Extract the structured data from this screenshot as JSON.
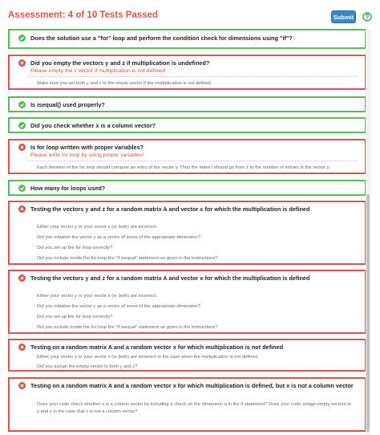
{
  "header": {
    "title": "Assessment: 4 of 10 Tests Passed",
    "submit_label": "Submit"
  },
  "colors": {
    "pass": "#5cb85c",
    "fail": "#d9534f",
    "submit": "#3a87c9",
    "help": "#3aa84a"
  },
  "tests": [
    {
      "status": "pass",
      "question": "Does the solution use a \"for\" loop and perform the condition check for dimensions using \"if\"?",
      "error": "",
      "hints": []
    },
    {
      "status": "fail",
      "question": "Did you empty the vectors y and z if multiplication is undefined?",
      "error": "Please empty the z vector if multiplication is not defined!",
      "hints": [
        "Make sure you set both y and z to the empty vector if the multiplication is not defined."
      ]
    },
    {
      "status": "pass",
      "question": "Is isequal() used properly?",
      "error": "",
      "hints": []
    },
    {
      "status": "pass",
      "question": "Did you check whether x is a column vector?",
      "error": "",
      "hints": []
    },
    {
      "status": "fail",
      "question": "Is for loop written with proper variables?",
      "error": "Please write for loop by using proper variables!",
      "hints": [
        "Each iteration of the for loop should compute an entry of the vector y. Thus the index  i  should go from 1 to the number of entries in the vector y."
      ]
    },
    {
      "status": "pass",
      "question": "How many for loops used?",
      "error": "",
      "hints": []
    },
    {
      "status": "fail",
      "question": "Testing the vectors y and z for a random matrix A and vector x for which the multiplication is defined",
      "error": "",
      "hints": [
        "Either your vector y or your vector z (or both) are incorrect.",
        "Did you initialize the vector y as a vector of zeros of the appropriate dimension?",
        "Did you set up the for loop correctly?",
        "Did you include inside the for loop the \"if isequal\" statement as given in the instructions?"
      ]
    },
    {
      "status": "fail",
      "question": "Testing the vectors y and z for a random matrix A and vector x for which the multiplication is defined",
      "error": "",
      "hints": [
        "Either your vector y or your vector z (or both) are incorrect.",
        "Did you initialize the vector y as a vector of zeros of the appropriate dimension?",
        "Did you set up the for loop correctly?",
        "Did you include inside the for loop the \"if isequal\" statement as given in the instructions?"
      ]
    },
    {
      "status": "fail",
      "question": "Testing on a random matrix A and a random vector x for which multiplication is not defined",
      "error": "",
      "hints": [
        "Either your vector y or your vector z (or both) are incorrect in the case when the multiplication is not defined.",
        "Did you assign the empty vector to both y and z?"
      ]
    },
    {
      "status": "fail",
      "question": "Testing on a random matrix A and a random vector x for which multiplication is defined, but x is not a column vector",
      "error": "",
      "hints": [
        "Does your code check whether x is a column vector by including a check on the dimension q in the if statement? Does your code assign empty vectors to y and z in the case that x is not a  column vector?"
      ]
    }
  ]
}
